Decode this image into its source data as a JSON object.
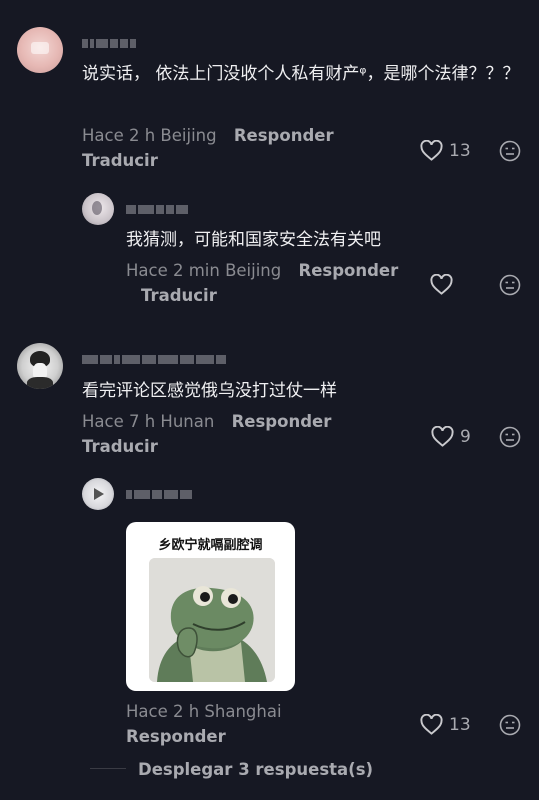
{
  "comments": [
    {
      "text": "说实话， 依法上门没收个人私有财产ᵠ，是哪个法律？？？",
      "meta": "Hace 2 h Beijing",
      "reply_label": "Responder",
      "translate_label": "Traducir",
      "likes": "13",
      "replies": [
        {
          "text": "我猜测，可能和国家安全法有关吧",
          "meta": "Hace 2 min Beijing",
          "reply_label": "Responder",
          "translate_label": "Traducir"
        }
      ]
    },
    {
      "text": "看完评论区感觉俄乌没打过仗一样",
      "meta": "Hace 7 h Hunan",
      "reply_label": "Responder",
      "translate_label": "Traducir",
      "likes": "9",
      "replies": [
        {
          "sticker_caption": "乡欧宁就嗝副腔调",
          "meta": "Hace 2 h Shanghai",
          "reply_label": "Responder",
          "likes": "13"
        }
      ]
    }
  ],
  "expand_replies_label": "Desplegar 3 respuesta(s)",
  "icons": {
    "like": "heart-outline-icon",
    "emoji": "neutral-face-icon",
    "expand": "expand-line"
  },
  "colors": {
    "background": "#161823",
    "text_primary": "#f0f0f2",
    "text_secondary": "#8a8b91",
    "action": "#a9aab0"
  }
}
